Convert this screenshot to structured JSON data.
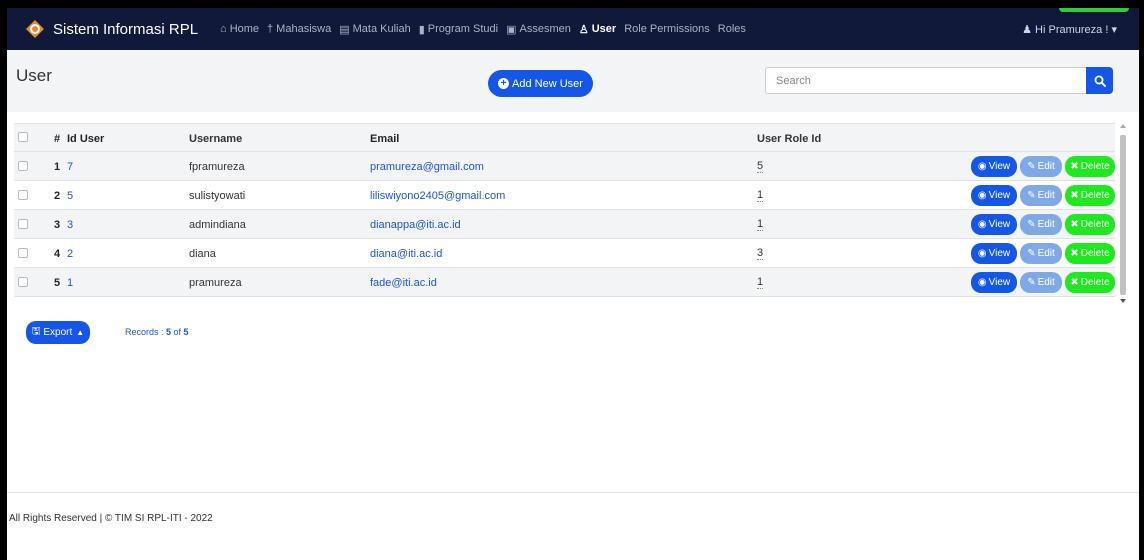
{
  "app": {
    "brand": "Sistem Informasi RPL"
  },
  "nav": {
    "items": [
      {
        "label": "Home",
        "icon": "home-icon",
        "glyph": "⌂",
        "active": false
      },
      {
        "label": "Mahasiswa",
        "icon": "person-icon",
        "glyph": "†",
        "active": false
      },
      {
        "label": "Mata Kuliah",
        "icon": "book-icon",
        "glyph": "▤",
        "active": false
      },
      {
        "label": "Program Studi",
        "icon": "bookmark-icon",
        "glyph": "▮",
        "active": false
      },
      {
        "label": "Assesmen",
        "icon": "list-icon",
        "glyph": "▣",
        "active": false
      },
      {
        "label": "User",
        "icon": "user-icon",
        "glyph": "♙",
        "active": true
      },
      {
        "label": "Role Permissions",
        "icon": "",
        "glyph": "",
        "active": false
      },
      {
        "label": "Roles",
        "icon": "",
        "glyph": "",
        "active": false
      }
    ],
    "user_greeting": "Hi Pramureza !"
  },
  "page": {
    "title": "User",
    "add_button": "Add New User",
    "search_placeholder": "Search"
  },
  "table": {
    "headers": {
      "num": "#",
      "id": "Id User",
      "username": "Username",
      "email": "Email",
      "role": "User Role Id"
    },
    "rows": [
      {
        "num": "1",
        "id": "7",
        "username": "fpramureza",
        "email": "pramureza@gmail.com",
        "role": "5"
      },
      {
        "num": "2",
        "id": "5",
        "username": "sulistyowati",
        "email": "liliswiyono2405@gmail.com",
        "role": "1"
      },
      {
        "num": "3",
        "id": "3",
        "username": "admindiana",
        "email": "dianappa@iti.ac.id",
        "role": "1"
      },
      {
        "num": "4",
        "id": "2",
        "username": "diana",
        "email": "diana@iti.ac.id",
        "role": "3"
      },
      {
        "num": "5",
        "id": "1",
        "username": "pramureza",
        "email": "fade@iti.ac.id",
        "role": "1"
      }
    ],
    "actions": {
      "view": "View",
      "edit": "Edit",
      "delete": "Delete"
    }
  },
  "bottom": {
    "export_label": "Export",
    "records_prefix": "Records : ",
    "records_count": "5",
    "records_of": " of ",
    "records_total": "5"
  },
  "footer": {
    "text": "All Rights Reserved | © TIM SI RPL-ITI - 2022"
  },
  "colors": {
    "navbar": "#10193a",
    "primary": "#1356e8",
    "success": "#1ee81e",
    "edit": "#7fa8e6"
  }
}
